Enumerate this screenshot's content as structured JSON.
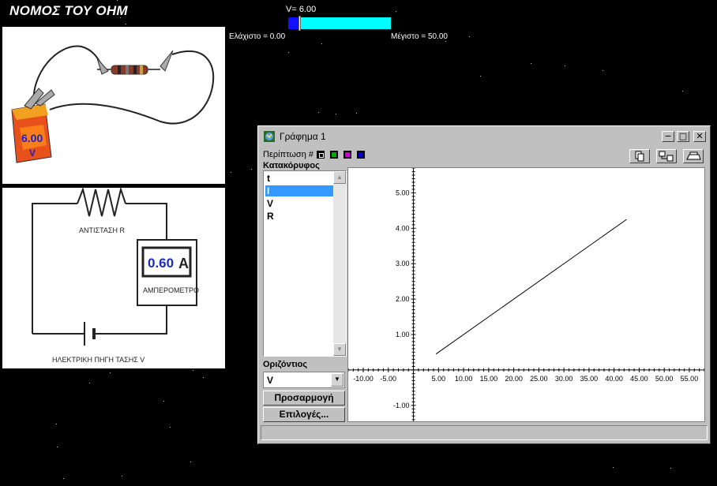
{
  "app": {
    "title": "ΝΟΜΟΣ ΤΟΥ ΟΗΜ"
  },
  "voltage_slider": {
    "value_label": "V= 6.00",
    "min_label": "Ελάχιστο = 0.00",
    "max_label": "Μέγιστο = 50.00",
    "value": 6.0,
    "min": 0,
    "max": 50
  },
  "circuit": {
    "battery_value": "6.00",
    "battery_unit": "V",
    "resistor_label": "ΑΝΤΙΣΤΑΣΗ R",
    "ammeter_value": "0.60",
    "ammeter_unit": "A",
    "ammeter_label": "ΑΜΠΕΡΟΜΕΤΡΟ",
    "source_label": "ΗΛΕΚΤΡΙΚΗ ΠΗΓΗ ΤΑΣΗΣ V"
  },
  "graph_window": {
    "title": "Γράφημα 1",
    "case_label": "Περίπτωση #",
    "vertical_label": "Κατακόρυφος",
    "vertical_items": [
      "t",
      "I",
      "V",
      "R"
    ],
    "selected_vertical": "I",
    "horizontal_label": "Οριζόντιος",
    "horizontal_value": "V",
    "fit_button": "Προσαρμογή",
    "options_button": "Επιλογές...",
    "case_colors": [
      "#000000",
      "#00aa00",
      "#cc00cc",
      "#0000cc"
    ]
  },
  "chart_data": {
    "type": "line",
    "x_ticks": [
      "-10.00",
      "-5.00",
      "5.00",
      "10.00",
      "15.00",
      "20.00",
      "25.00",
      "30.00",
      "35.00",
      "40.00",
      "45.00",
      "50.00",
      "55.00"
    ],
    "y_ticks": [
      "5.00",
      "4.00",
      "3.00",
      "2.00",
      "1.00",
      "-1.00"
    ],
    "xlim": [
      -13,
      58
    ],
    "ylim": [
      -1.45,
      5.7
    ],
    "series": [
      {
        "x": [
          4.5,
          42.5
        ],
        "y": [
          0.45,
          4.25
        ]
      }
    ]
  }
}
